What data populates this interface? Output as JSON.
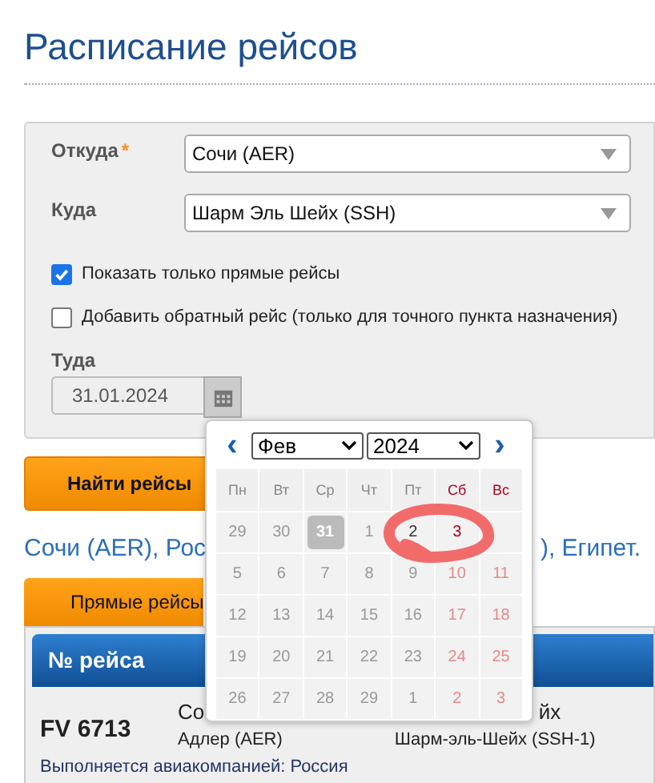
{
  "title": "Расписание рейсов",
  "form": {
    "fields": [
      {
        "label": "Откуда",
        "required_mark": "*",
        "value": "Сочи (AER)"
      },
      {
        "label": "Куда",
        "value": "Шарм Эль Шейх (SSH)"
      }
    ],
    "checkboxes": [
      {
        "label": "Показать только прямые рейсы",
        "checked": true
      },
      {
        "label": "Добавить обратный рейс (только для точного пункта назначения)",
        "checked": false
      }
    ],
    "date": {
      "label": "Туда",
      "value": "31.01.2024"
    }
  },
  "search_button": "Найти рейсы",
  "route": {
    "left": "Сочи (AER), Рос",
    "right": "), Египет."
  },
  "tab": "Прямые рейсы",
  "table": {
    "header": "№ рейса",
    "row": {
      "flight": "FV 6713",
      "from_city": "Со",
      "from_airport": "Адлер (AER)",
      "to_city": "йх",
      "to_airport": "Шарм-эль-Шейх (SSH-1)"
    },
    "note": "Выполняется авиакомпанией: Россия"
  },
  "calendar": {
    "prev": "‹",
    "next": "›",
    "month": "Фев",
    "year": "2024",
    "weekdays": [
      {
        "label": "Пн",
        "weekend": false
      },
      {
        "label": "Вт",
        "weekend": false
      },
      {
        "label": "Ср",
        "weekend": false
      },
      {
        "label": "Чт",
        "weekend": false
      },
      {
        "label": "Пт",
        "weekend": false
      },
      {
        "label": "Сб",
        "weekend": true
      },
      {
        "label": "Вс",
        "weekend": true
      }
    ],
    "weeks": [
      [
        {
          "day": "29",
          "disabled": true,
          "selected": false
        },
        {
          "day": "30",
          "disabled": true,
          "selected": false
        },
        {
          "day": "31",
          "disabled": false,
          "selected": true
        },
        {
          "day": "1",
          "disabled": true,
          "selected": false
        },
        {
          "day": "2",
          "disabled": false,
          "selected": false
        },
        {
          "day": "3",
          "disabled": false,
          "selected": false
        }
      ],
      [
        {
          "day": "5",
          "disabled": true,
          "selected": false
        },
        {
          "day": "6",
          "disabled": true,
          "selected": false
        },
        {
          "day": "7",
          "disabled": true,
          "selected": false
        },
        {
          "day": "8",
          "disabled": true,
          "selected": false
        },
        {
          "day": "9",
          "disabled": true,
          "selected": false
        },
        {
          "day": "10",
          "disabled": true,
          "selected": false
        },
        {
          "day": "11",
          "disabled": true,
          "selected": false
        }
      ],
      [
        {
          "day": "12",
          "disabled": true,
          "selected": false
        },
        {
          "day": "13",
          "disabled": true,
          "selected": false
        },
        {
          "day": "14",
          "disabled": true,
          "selected": false
        },
        {
          "day": "15",
          "disabled": true,
          "selected": false
        },
        {
          "day": "16",
          "disabled": true,
          "selected": false
        },
        {
          "day": "17",
          "disabled": true,
          "selected": false
        },
        {
          "day": "18",
          "disabled": true,
          "selected": false
        }
      ],
      [
        {
          "day": "19",
          "disabled": true,
          "selected": false
        },
        {
          "day": "20",
          "disabled": true,
          "selected": false
        },
        {
          "day": "21",
          "disabled": true,
          "selected": false
        },
        {
          "day": "22",
          "disabled": true,
          "selected": false
        },
        {
          "day": "23",
          "disabled": true,
          "selected": false
        },
        {
          "day": "24",
          "disabled": true,
          "selected": false
        },
        {
          "day": "25",
          "disabled": true,
          "selected": false
        }
      ],
      [
        {
          "day": "26",
          "disabled": true,
          "selected": false
        },
        {
          "day": "27",
          "disabled": true,
          "selected": false
        },
        {
          "day": "28",
          "disabled": true,
          "selected": false
        },
        {
          "day": "29",
          "disabled": true,
          "selected": false
        },
        {
          "day": "1",
          "disabled": true,
          "selected": false
        },
        {
          "day": "2",
          "disabled": true,
          "selected": false
        },
        {
          "day": "3",
          "disabled": true,
          "selected": false
        }
      ]
    ]
  },
  "annotation": {
    "kind": "scribble",
    "color": "#f26b6b"
  }
}
